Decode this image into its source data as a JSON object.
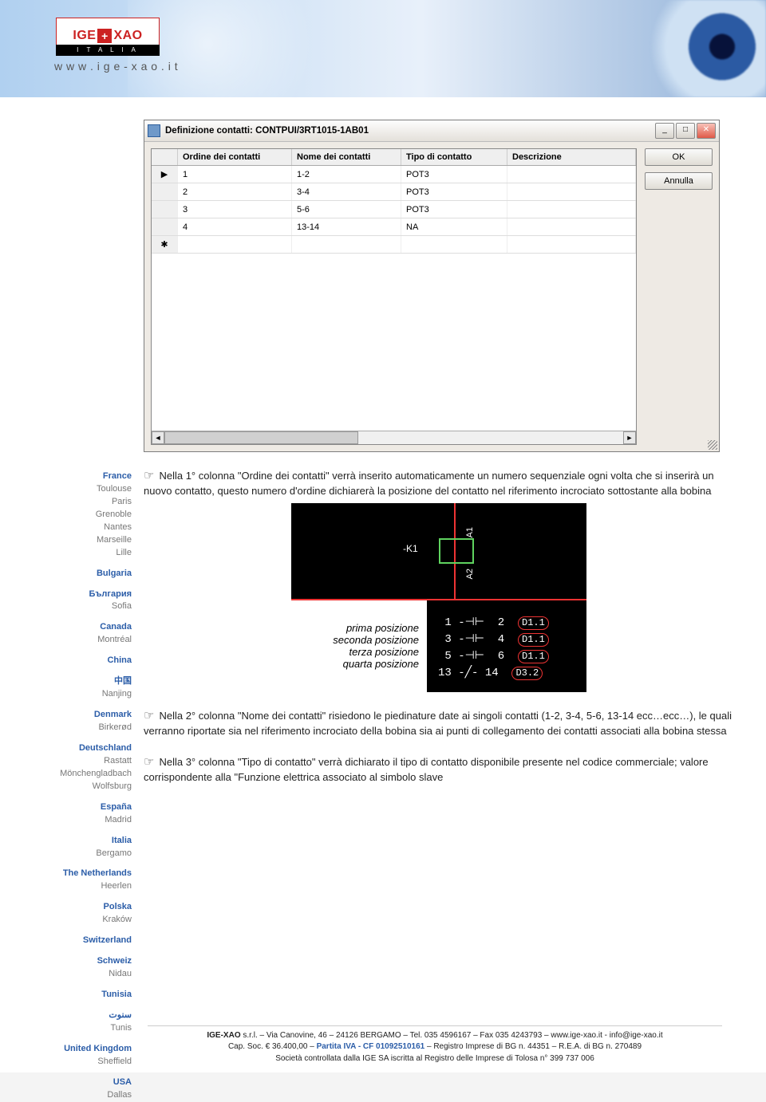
{
  "logo": {
    "text1": "IGE",
    "text2": "XAO",
    "strip": "I T A L I A",
    "url": "w w w . i g e - x a o . i t"
  },
  "dialog": {
    "title": "Definizione contatti: CONTPUI/3RT1015-1AB01",
    "headers": [
      "Ordine dei contatti",
      "Nome dei contatti",
      "Tipo di contatto",
      "Descrizione"
    ],
    "rows": [
      {
        "sel": "▶",
        "c1": "1",
        "c2": "1-2",
        "c3": "POT3",
        "c4": ""
      },
      {
        "sel": "",
        "c1": "2",
        "c2": "3-4",
        "c3": "POT3",
        "c4": ""
      },
      {
        "sel": "",
        "c1": "3",
        "c2": "5-6",
        "c3": "POT3",
        "c4": ""
      },
      {
        "sel": "",
        "c1": "4",
        "c2": "13-14",
        "c3": "NA",
        "c4": ""
      },
      {
        "sel": "✱",
        "c1": "",
        "c2": "",
        "c3": "",
        "c4": ""
      }
    ],
    "buttons": {
      "ok": "OK",
      "cancel": "Annulla"
    }
  },
  "para1": "Nella 1° colonna \"Ordine dei contatti\" verrà inserito automaticamente un numero sequenziale ogni volta che si inserirà un nuovo contatto, questo numero d'ordine dichiarerà la posizione del contatto nel riferimento incrociato sottostante alla bobina",
  "diagram": {
    "k1": "-K1",
    "a1": "A1",
    "a2": "A2"
  },
  "positions": {
    "p1": "prima posizione",
    "p2": "seconda posizione",
    "p3": "terza posizione",
    "p4": "quarta posizione"
  },
  "crossref": {
    "l1": {
      "a": " 1 -⊣⊢  2 ",
      "d": "D1.1"
    },
    "l2": {
      "a": " 3 -⊣⊢  4 ",
      "d": "D1.1"
    },
    "l3": {
      "a": " 5 -⊣⊢  6 ",
      "d": "D1.1"
    },
    "l4": {
      "a": "13 -╱- 14 ",
      "d": "D3.2"
    }
  },
  "para2": "Nella 2° colonna \"Nome dei contatti\" risiedono le piedinature date ai singoli contatti (1-2, 3-4, 5-6, 13-14 ecc…ecc…), le quali verranno riportate sia nel riferimento incrociato della bobina sia ai punti di collegamento dei contatti associati alla bobina stessa",
  "para3": "Nella 3° colonna \"Tipo di contatto\" verrà dichiarato il tipo di contatto disponibile presente nel codice commerciale; valore corrispondente alla \"Funzione elettrica associato al simbolo slave",
  "sidebar": [
    {
      "country": "France",
      "cities": [
        "Toulouse",
        "Paris",
        "Grenoble",
        "Nantes",
        "Marseille",
        "Lille"
      ]
    },
    {
      "country": "Bulgaria",
      "native": "България",
      "cities": [
        "Sofia"
      ]
    },
    {
      "country": "Canada",
      "cities": [
        "Montréal"
      ]
    },
    {
      "country": "China",
      "native": "中国",
      "cities": [
        "Nanjing"
      ]
    },
    {
      "country": "Denmark",
      "cities": [
        "Birkerød"
      ]
    },
    {
      "country": "Deutschland",
      "cities": [
        "Rastatt",
        "Mönchengladbach",
        "Wolfsburg"
      ]
    },
    {
      "country": "España",
      "cities": [
        "Madrid"
      ]
    },
    {
      "country": "Italia",
      "cities": [
        "Bergamo"
      ]
    },
    {
      "country": "The Netherlands",
      "cities": [
        "Heerlen"
      ]
    },
    {
      "country": "Polska",
      "cities": [
        "Kraków"
      ]
    },
    {
      "country": "Switzerland",
      "native": "Schweiz",
      "cities": [
        "Nidau"
      ]
    },
    {
      "country": "Tunisia",
      "native": "سنوت",
      "cities": [
        "Tunis"
      ]
    },
    {
      "country": "United Kingdom",
      "cities": [
        "Sheffield"
      ]
    },
    {
      "country": "USA",
      "cities": [
        "Dallas"
      ]
    }
  ],
  "footer": {
    "l1a": "IGE-XAO ",
    "l1b": "s.r.l. – Via Canovine, 46 – 24126 BERGAMO – Tel. 035 4596167 – Fax 035 4243793 – www.ige-xao.it - info@ige-xao.it",
    "l2a": "Cap. Soc. € 36.400,00 – ",
    "l2piva": "Partita IVA - CF 01092510161",
    "l2b": " – Registro Imprese di BG n. 44351 – R.E.A. di BG n. 270489",
    "l3": "Società controllata dalla IGE SA iscritta al Registro delle Imprese di Tolosa n° 399 737 006"
  }
}
